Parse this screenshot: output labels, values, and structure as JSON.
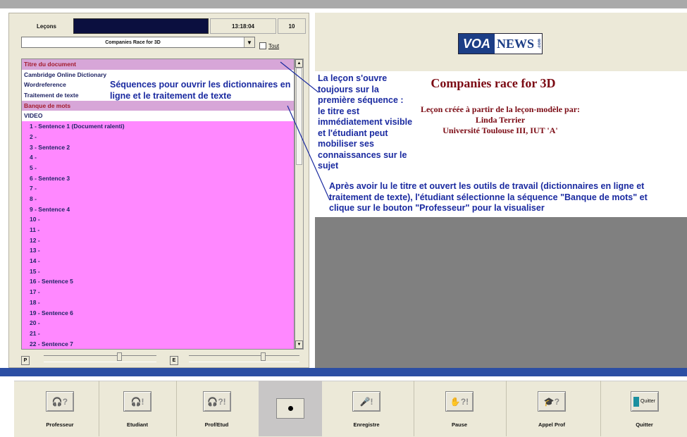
{
  "header": {
    "lecons": "Leçons",
    "time": "13:18:04",
    "count": "10"
  },
  "lesson_select": {
    "value": "Companies Race for 3D"
  },
  "tout_checkbox": {
    "label": "Tout"
  },
  "list_items": [
    "Titre du document",
    "Cambridge Online Dictionary",
    "Wordreference",
    "Traitement de texte",
    "Banque de mots",
    "VIDEO",
    "1 - Sentence 1 (Document ralenti)",
    "2 -",
    "3 - Sentence 2",
    "4 -",
    "5 -",
    "6 - Sentence 3",
    "7 -",
    "8 -",
    "9 - Sentence 4",
    "10 -",
    "11 -",
    "12 -",
    "13 -",
    "14 -",
    "15 -",
    "16 - Sentence 5",
    "17 -",
    "18 -",
    "19 - Sentence 6",
    "20 -",
    "21 -",
    "22 - Sentence 7"
  ],
  "sliders": {
    "p_label": "P",
    "e_label": "E"
  },
  "logo": {
    "voa": "VOA",
    "news": "NEWS",
    "dotcom": ".com"
  },
  "document": {
    "title": "Companies race for 3D",
    "credits_line1": "Leçon créée à partir de la leçon-modèle par:",
    "credits_line2": "Linda Terrier",
    "credits_line3": "Université Toulouse III, IUT 'A'"
  },
  "annotations": {
    "sequences": "Séquences pour ouvrir les dictionnaires en ligne et le traitement de texte",
    "first_sequence": "La leçon s'ouvre toujours sur la première séquence : le titre est immédiatement visible et l'étudiant peut mobiliser ses connaissances sur le sujet",
    "after": "Après avoir lu le titre et ouvert les outils de travail (dictionnaires en ligne et traitement de texte), l'étudiant sélectionne la séquence \"Banque de mots\" et clique sur le bouton \"Professeur\" pour la visualiser"
  },
  "toolbar": {
    "professeur": "Professeur",
    "etudiant": "Etudiant",
    "prof_etud": "Prof/Etud",
    "enregistre": "Enregistre",
    "pause": "Pause",
    "appel_prof": "Appel Prof",
    "quitter": "Quitter",
    "quitter_btn": "Quitter"
  },
  "colors": {
    "navy": "#0b0f3f",
    "pink": "#ff88ff",
    "selected_pink": "#d7a6d8",
    "annotation_blue": "#1a2aa0",
    "title_red": "#7b0a13"
  }
}
